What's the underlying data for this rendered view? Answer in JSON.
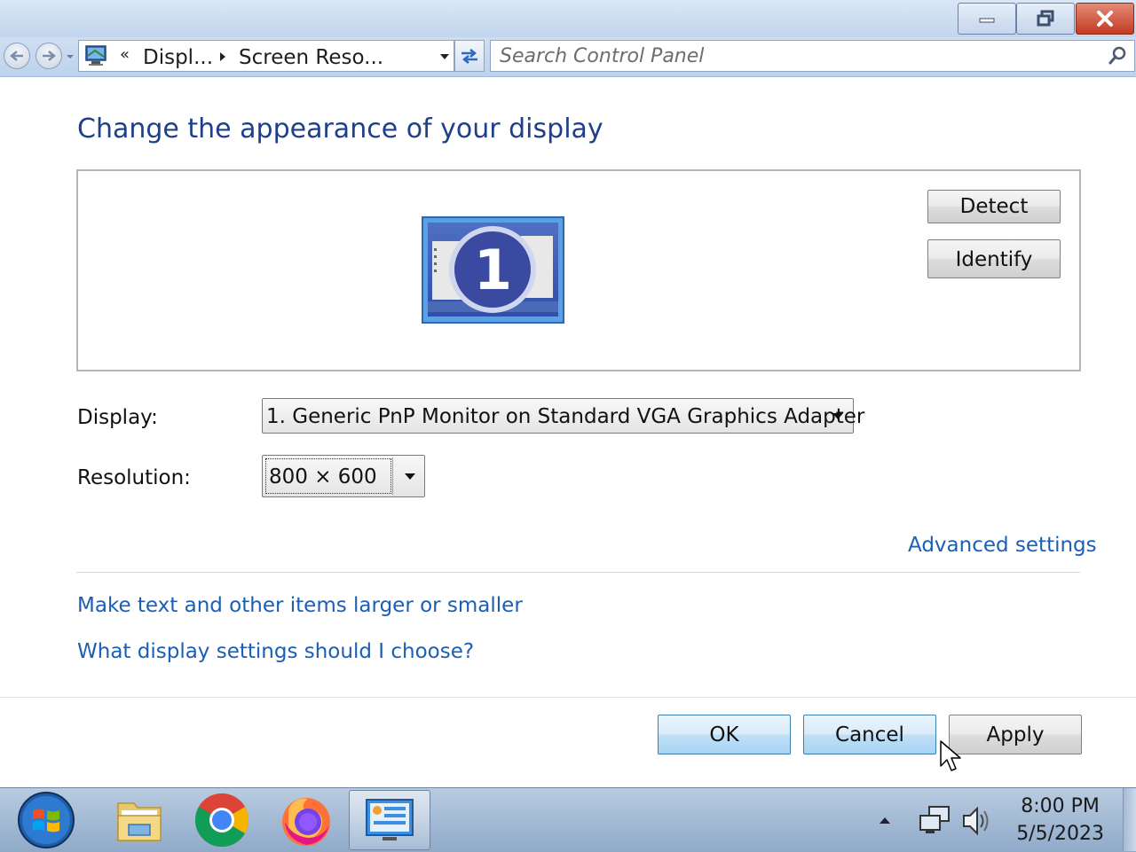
{
  "window": {
    "buttons": [
      "minimize",
      "restore",
      "close"
    ]
  },
  "addressbar": {
    "overflow": "«",
    "crumbs": [
      "Displ...",
      "Screen Reso..."
    ],
    "search_placeholder": "Search Control Panel"
  },
  "content": {
    "heading": "Change the appearance of your display",
    "monitor_number": "1",
    "detect_label": "Detect",
    "identify_label": "Identify",
    "display_label": "Display:",
    "display_value": "1. Generic PnP Monitor on Standard VGA Graphics Adapter",
    "resolution_label": "Resolution:",
    "resolution_value": "800 × 600",
    "advanced_link": "Advanced settings",
    "text_size_link": "Make text and other items larger or smaller",
    "help_link": "What display settings should I choose?"
  },
  "footer": {
    "ok_label": "OK",
    "cancel_label": "Cancel",
    "apply_label": "Apply"
  },
  "taskbar": {
    "items": [
      "start-orb",
      "file-explorer",
      "chrome",
      "firefox",
      "control-panel-screen-resolution"
    ],
    "time": "8:00 PM",
    "date": "5/5/2023"
  }
}
